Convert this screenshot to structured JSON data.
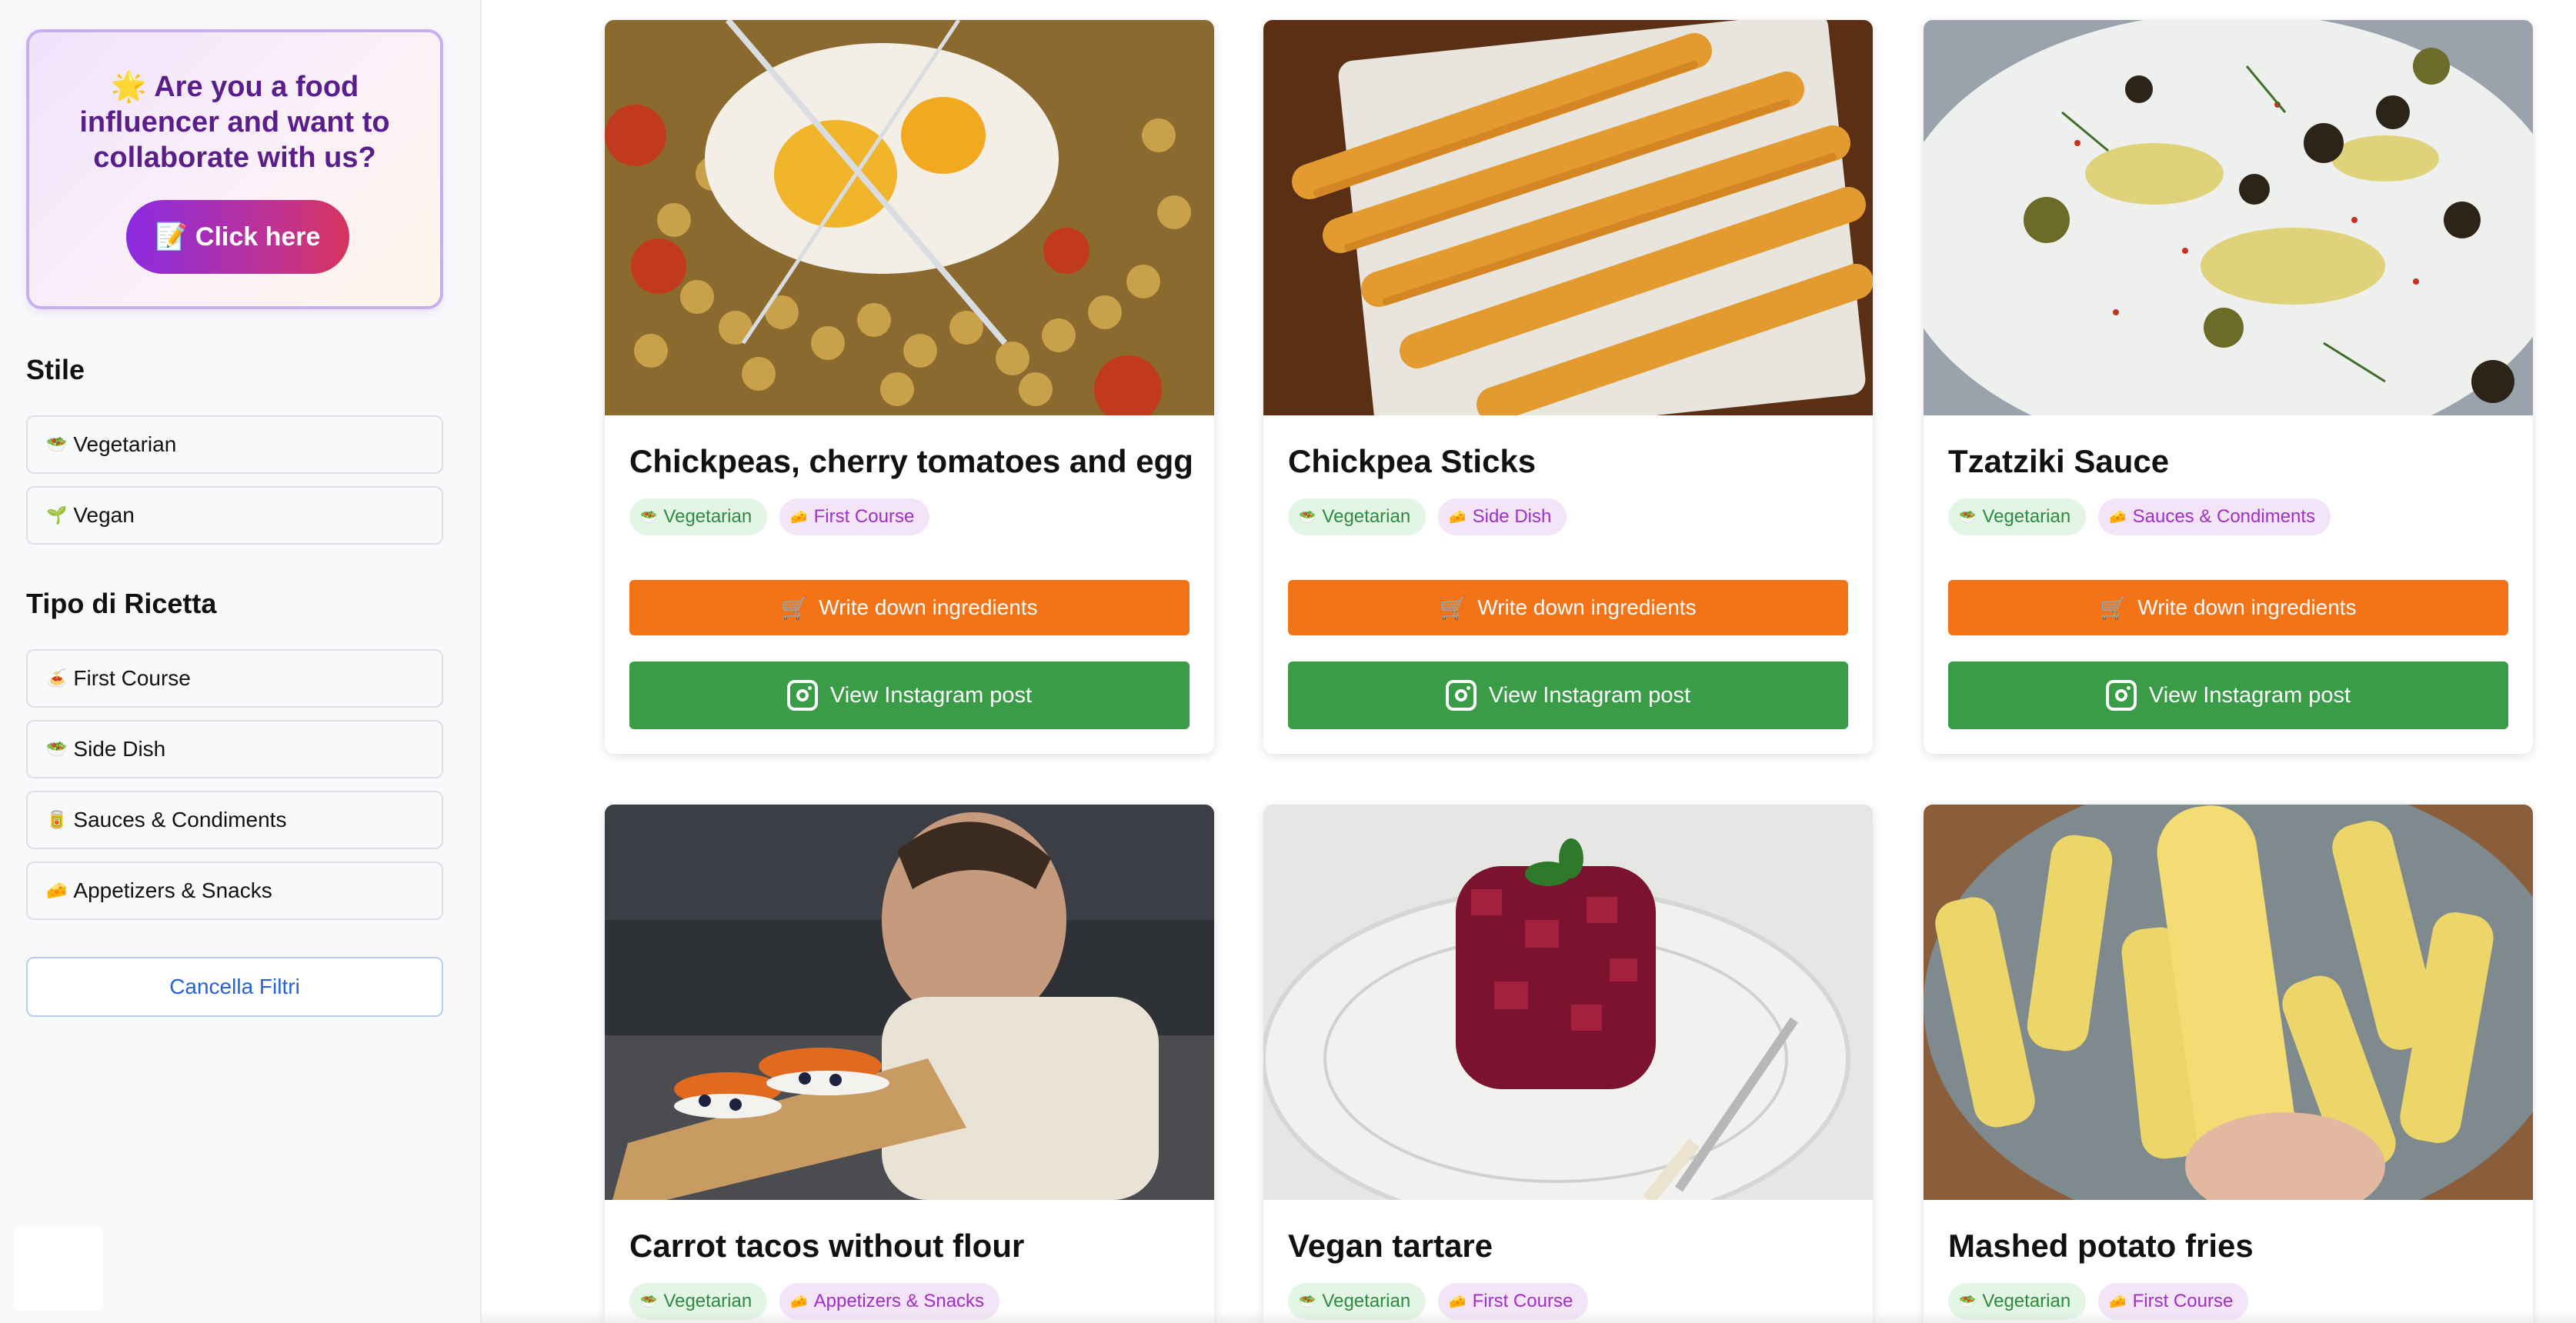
{
  "promo": {
    "icon": "star-emoji",
    "emoji": "🌟",
    "text": "Are you a food influencer and want to collaborate with us?",
    "button_emoji": "📝",
    "button_label": "Click here"
  },
  "filters": {
    "stile_title": "Stile",
    "stile_items": [
      {
        "emoji": "🥗",
        "label": "Vegetarian"
      },
      {
        "emoji": "🌱",
        "label": "Vegan"
      }
    ],
    "tipo_title": "Tipo di Ricetta",
    "tipo_items": [
      {
        "emoji": "🍝",
        "label": "First Course"
      },
      {
        "emoji": "🥗",
        "label": "Side Dish"
      },
      {
        "emoji": "🥫",
        "label": "Sauces & Condiments"
      },
      {
        "emoji": "🧀",
        "label": "Appetizers & Snacks"
      }
    ],
    "clear_label": "Cancella Filtri"
  },
  "buttons": {
    "ingredients_label": "Write down ingredients",
    "instagram_label": "View Instagram post"
  },
  "colors": {
    "accent_orange": "#f47317",
    "accent_green": "#3a9c47",
    "promo_purple": "#5a1e8c"
  },
  "recipes": [
    {
      "title": "Chickpeas, cherry tomatoes and egg",
      "tags": [
        {
          "emoji": "🥗",
          "label": "Vegetarian"
        },
        {
          "emoji": "🧀",
          "label": "First Course"
        }
      ]
    },
    {
      "title": "Chickpea Sticks",
      "tags": [
        {
          "emoji": "🥗",
          "label": "Vegetarian"
        },
        {
          "emoji": "🧀",
          "label": "Side Dish"
        }
      ]
    },
    {
      "title": "Tzatziki Sauce",
      "tags": [
        {
          "emoji": "🥗",
          "label": "Vegetarian"
        },
        {
          "emoji": "🧀",
          "label": "Sauces & Condiments"
        }
      ]
    },
    {
      "title": "Carrot tacos without flour",
      "tags": [
        {
          "emoji": "🥗",
          "label": "Vegetarian"
        },
        {
          "emoji": "🧀",
          "label": "Appetizers & Snacks"
        }
      ]
    },
    {
      "title": "Vegan tartare",
      "tags": [
        {
          "emoji": "🥗",
          "label": "Vegetarian"
        },
        {
          "emoji": "🧀",
          "label": "First Course"
        }
      ]
    },
    {
      "title": "Mashed potato fries",
      "tags": [
        {
          "emoji": "🥗",
          "label": "Vegetarian"
        },
        {
          "emoji": "🧀",
          "label": "First Course"
        }
      ]
    }
  ]
}
